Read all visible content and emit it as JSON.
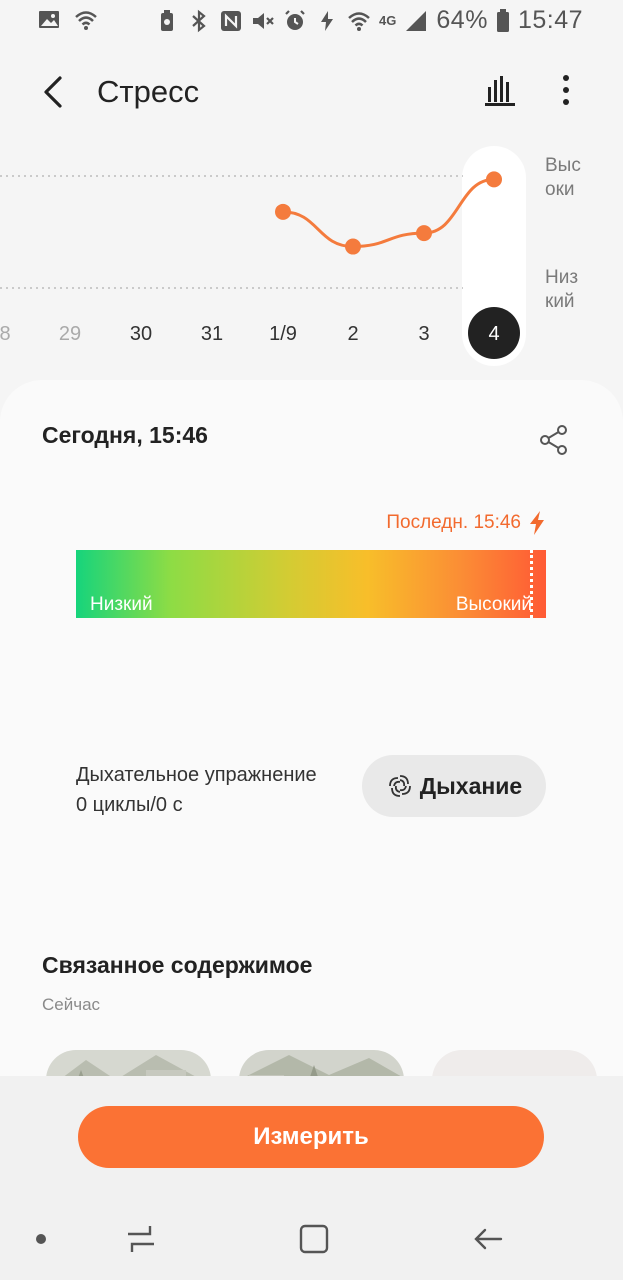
{
  "status_bar": {
    "battery_percent": "64%",
    "time": "15:47",
    "network_type": "4G",
    "left_icons": [
      "image-icon",
      "wifi-icon"
    ],
    "right_icons": [
      "battery-saver-icon",
      "bluetooth-icon",
      "nfc-icon",
      "mute-icon",
      "alarm-icon",
      "data-saver-icon",
      "wifi-icon",
      "signal-icon",
      "battery-icon"
    ]
  },
  "appbar": {
    "title": "Стресс",
    "icons": [
      "back-arrow-icon",
      "bar-chart-icon",
      "more-vertical-icon"
    ]
  },
  "chart_data": {
    "type": "line",
    "categories": [
      "8",
      "29",
      "30",
      "31",
      "1/9",
      "2",
      "3",
      "4"
    ],
    "selected_index": 7,
    "series": [
      {
        "values": [
          null,
          null,
          null,
          null,
          0.68,
          0.37,
          0.49,
          0.97
        ]
      }
    ],
    "ylim": [
      0,
      1
    ],
    "level_labels": {
      "high": "Выс\nоки",
      "low": "Низ\nкий"
    },
    "line_color": "#f47b3d",
    "grid": "dotted"
  },
  "card": {
    "date_title": "Сегодня, 15:46",
    "last_label": "Последн. 15:46",
    "gauge": {
      "low_label": "Низкий",
      "high_label": "Высокий",
      "current_fraction": 0.97
    },
    "breathing": {
      "title": "Дыхательное упражнение",
      "subtitle": "0 циклы/0 с",
      "button_label": "Дыхание"
    },
    "related": {
      "title": "Связанное содержимое",
      "subtitle": "Сейчас"
    }
  },
  "measure_button": "Измерить",
  "colors": {
    "accent": "#fb7234",
    "selected_day": "#222222"
  }
}
